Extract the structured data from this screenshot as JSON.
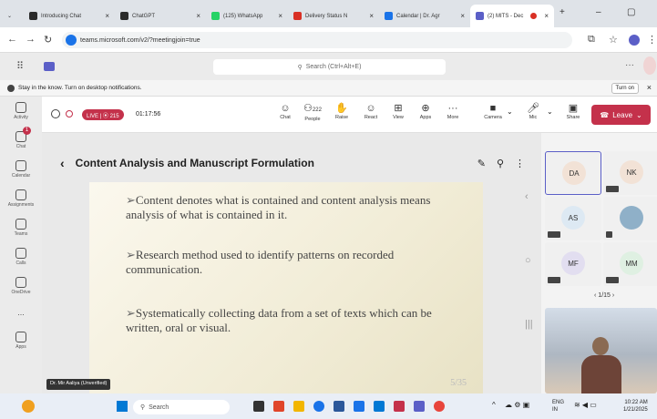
{
  "browser": {
    "tabs": [
      {
        "label": "Introducing Chat",
        "color": "#2b2b2b"
      },
      {
        "label": "ChatGPT",
        "color": "#2b2b2b"
      },
      {
        "label": "(125) WhatsApp",
        "color": "#25d366"
      },
      {
        "label": "Delivery Status N",
        "color": "#d93025"
      },
      {
        "label": "Calendar | Dr. Agr",
        "color": "#1a73e8"
      },
      {
        "label": "(2) MITS - Dec",
        "color": "#5b5fc7"
      }
    ],
    "url": "teams.microsoft.com/v2/?meetingjoin=true"
  },
  "teams": {
    "search_placeholder": "Search (Ctrl+Alt+E)",
    "notification": "Stay in the know. Turn on desktop notifications.",
    "turn_on_label": "Turn on",
    "rail": [
      {
        "label": "Activity"
      },
      {
        "label": "Chat",
        "badge": "1"
      },
      {
        "label": "Calendar"
      },
      {
        "label": "Assignments"
      },
      {
        "label": "Teams"
      },
      {
        "label": "Calls"
      },
      {
        "label": "OneDrive"
      },
      {
        "label": "..."
      },
      {
        "label": "Apps"
      }
    ]
  },
  "meeting": {
    "rec_label": "LIVE | ⦿ 215",
    "timer": "01:17:56",
    "toolbar": {
      "chat": "Chat",
      "people": "People",
      "people_count": "222",
      "raise": "Raise",
      "react": "React",
      "view": "View",
      "apps": "Apps",
      "more": "More",
      "camera": "Camera",
      "mic": "Mic",
      "share": "Share",
      "leave": "Leave"
    }
  },
  "slide_header": "Content Analysis and Manuscript Formulation",
  "slide": {
    "bullets": [
      "Content denotes what is contained and content analysis means analysis of what is contained in it.",
      "Research method used to identify patterns on recorded communication.",
      "Systematically collecting data from a set of texts which can be written, oral or visual."
    ],
    "page": "5/35"
  },
  "presenter_label": "Dr. Mir Aaliya (Unverified)",
  "participants": [
    {
      "initials": "DA",
      "bg": "#f2e2d6"
    },
    {
      "initials": "NK",
      "bg": "#f2e2d6"
    },
    {
      "initials": "AS",
      "bg": "#dde9f3"
    },
    {
      "initials": "",
      "bg": "#8fb0c8"
    },
    {
      "initials": "MF",
      "bg": "#e2def0"
    },
    {
      "initials": "MM",
      "bg": "#dff0e2"
    }
  ],
  "pager": "1/15",
  "taskbar": {
    "search": "Search",
    "lang": "ENG",
    "region": "IN",
    "time": "10:22 AM",
    "date": "1/21/2025"
  }
}
